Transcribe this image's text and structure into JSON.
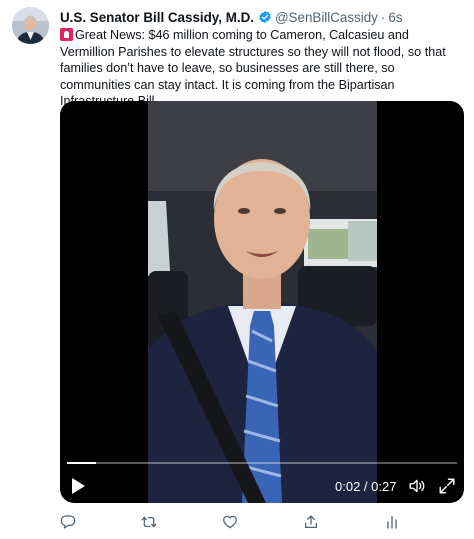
{
  "author": {
    "name": "U.S. Senator Bill Cassidy, M.D.",
    "handle": "@SenBillCassidy",
    "separator": "·",
    "time": "6s",
    "verified_color": "#1d9bf0"
  },
  "tweet": {
    "text": "Great News: $46 million coming to Cameron, Calcasieu and Vermillion Parishes to elevate structures so they will not flood, so that families don’t have to leave, so businesses are still there, so communities can stay intact. It is coming from the Bipartisan Infrastructure Bill.",
    "leading_emoji": "siren-emoji-icon"
  },
  "video": {
    "current_time": "0:02",
    "duration": "0:27",
    "time_display": "0:02 / 0:27",
    "progress_fraction": 0.074,
    "play_icon": "play-icon",
    "volume_icon": "volume-icon",
    "fullscreen_icon": "fullscreen-icon"
  },
  "actions": [
    {
      "name": "reply",
      "icon": "reply-icon"
    },
    {
      "name": "retweet",
      "icon": "retweet-icon"
    },
    {
      "name": "like",
      "icon": "heart-icon"
    },
    {
      "name": "share",
      "icon": "share-icon"
    },
    {
      "name": "analytics",
      "icon": "analytics-icon"
    }
  ],
  "colors": {
    "text": "#0f1419",
    "secondary": "#536471",
    "accent": "#1d9bf0"
  }
}
